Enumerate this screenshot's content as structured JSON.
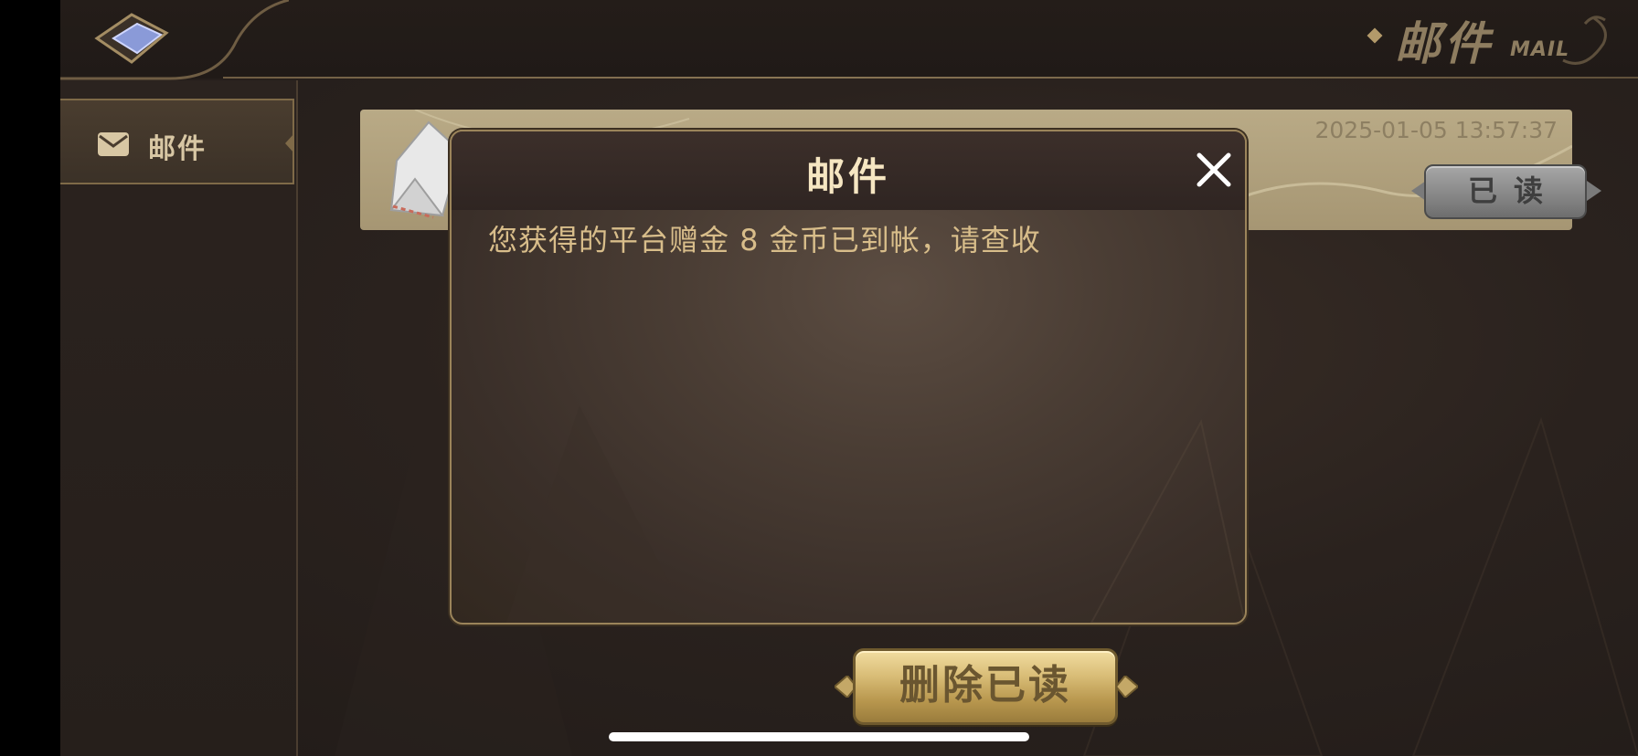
{
  "header": {
    "title": "邮件",
    "subtitle": "MAIL",
    "back_icon": "back-arrow-icon"
  },
  "sidebar": {
    "items": [
      {
        "label": "邮件",
        "icon": "envelope-icon",
        "selected": true
      }
    ]
  },
  "mail_list": {
    "items": [
      {
        "timestamp": "2025-01-05 13:57:37",
        "status_button": "已读",
        "icon": "open-envelope-icon"
      }
    ]
  },
  "modal": {
    "title": "邮件",
    "body": "您获得的平台赠金 8 金币已到帐，请查收",
    "close_icon": "close-icon"
  },
  "footer": {
    "delete_read_label": "删除已读"
  },
  "colors": {
    "background": "#2a221e",
    "accent_gold": "#b39a6a",
    "modal_title": "#f6e6c2",
    "modal_text": "#d8bd8a",
    "mail_row_bg": "#b9aa86"
  }
}
